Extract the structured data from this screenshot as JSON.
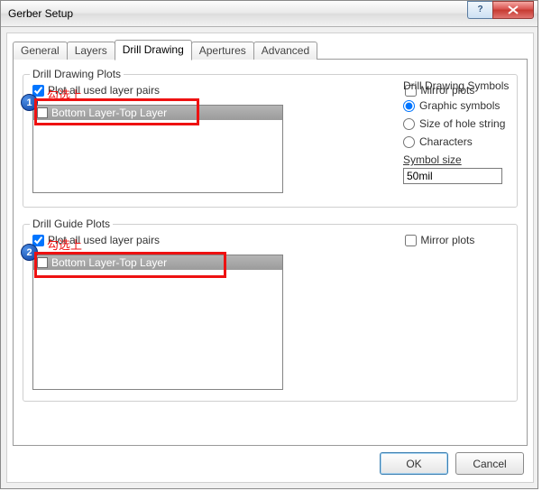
{
  "window": {
    "title": "Gerber Setup"
  },
  "tabs": {
    "general": "General",
    "layers": "Layers",
    "drill": "Drill Drawing",
    "apertures": "Apertures",
    "advanced": "Advanced",
    "active": "drill"
  },
  "drawing": {
    "legend": "Drill Drawing Plots",
    "plot_all": "Plot all used layer pairs",
    "plot_all_checked": true,
    "mirror": "Mirror plots",
    "mirror_checked": false,
    "layer_item": "Bottom Layer-Top Layer",
    "symbols_heading": "Drill Drawing Symbols",
    "radios": {
      "graphic": "Graphic symbols",
      "holesize": "Size of hole string",
      "chars": "Characters",
      "selected": "graphic"
    },
    "symbol_size_label": "Symbol size",
    "symbol_size_value": "50mil"
  },
  "guide": {
    "legend": "Drill Guide Plots",
    "plot_all": "Plot all used layer pairs",
    "plot_all_checked": true,
    "mirror": "Mirror plots",
    "mirror_checked": false,
    "layer_item": "Bottom Layer-Top Layer"
  },
  "buttons": {
    "ok": "OK",
    "cancel": "Cancel"
  },
  "annotations": {
    "text1": "勾选上",
    "text2": "勾选上",
    "badge1": "1",
    "badge2": "2"
  }
}
